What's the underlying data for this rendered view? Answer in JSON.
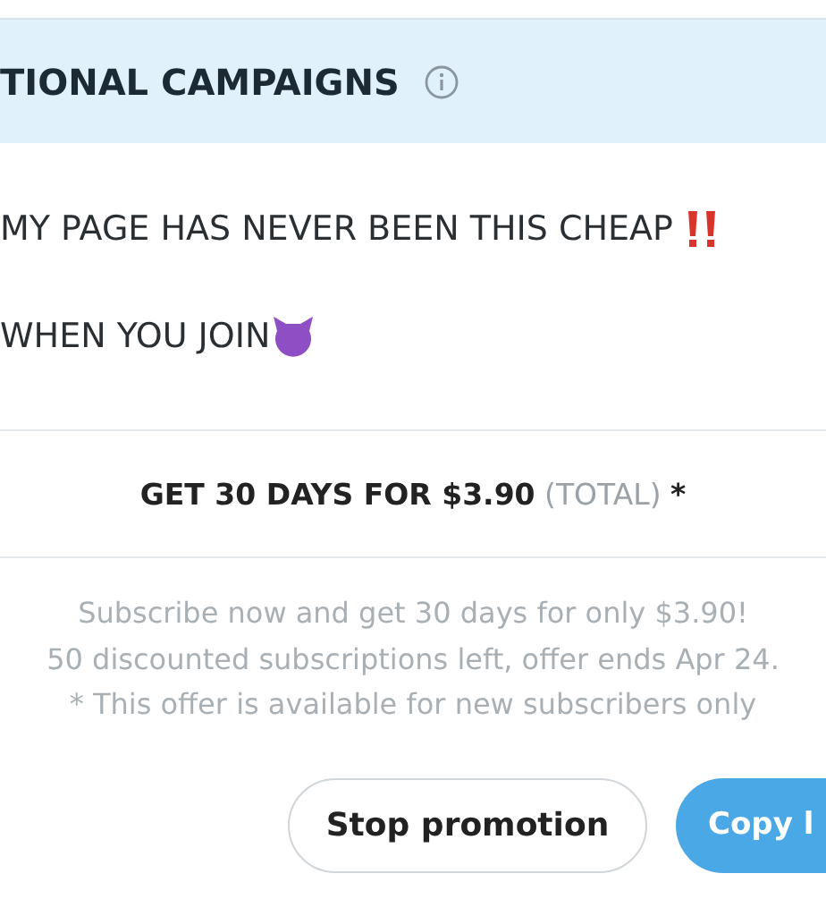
{
  "header": {
    "title": "TIONAL CAMPAIGNS"
  },
  "lines": [
    {
      "text": "MY PAGE HAS NEVER BEEN THIS CHEAP",
      "kind": "exclaim"
    },
    {
      "text": "WHEN YOU JOIN",
      "kind": "horned"
    }
  ],
  "offer": {
    "title": "GET 30 DAYS FOR $3.90",
    "note": "(TOTAL)",
    "mark": "*"
  },
  "description": [
    "Subscribe now and get 30 days for only $3.90!",
    "50 discounted subscriptions left, offer ends Apr 24.",
    "* This offer is available for new subscribers only"
  ],
  "buttons": [
    {
      "label": "Stop promotion",
      "kind": "outline"
    },
    {
      "label": "Copy l",
      "kind": "primary"
    }
  ]
}
